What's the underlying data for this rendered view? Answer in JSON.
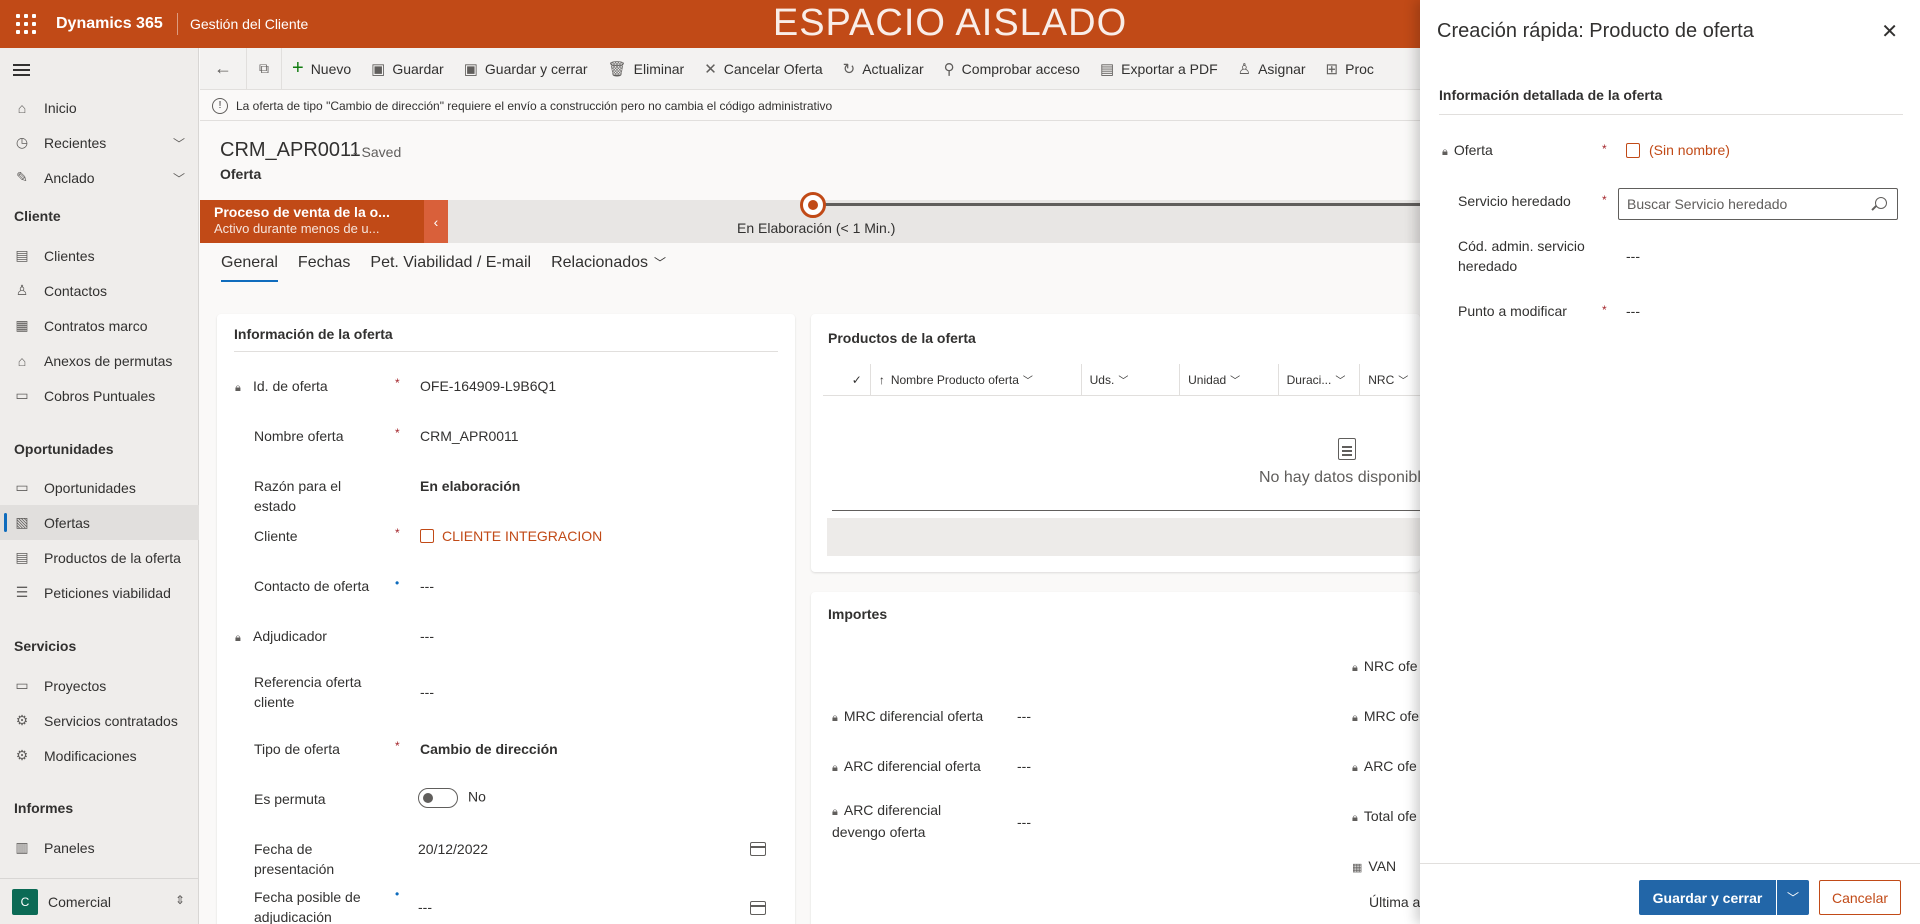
{
  "topbar": {
    "brand": "Dynamics 365",
    "app_name": "Gestión del Cliente",
    "sandbox_banner": "ESPACIO AISLADO"
  },
  "sidenav": {
    "items": [
      {
        "label": "Inicio",
        "icon": "home-icon"
      },
      {
        "label": "Recientes",
        "icon": "clock-icon"
      },
      {
        "label": "Anclado",
        "icon": "pin-icon"
      }
    ],
    "groups": [
      {
        "title": "Cliente",
        "items": [
          "Clientes",
          "Contactos",
          "Contratos marco",
          "Anexos de permutas",
          "Cobros Puntuales"
        ]
      },
      {
        "title": "Oportunidades",
        "items": [
          "Oportunidades",
          "Ofertas",
          "Productos de la oferta",
          "Peticiones viabilidad"
        ]
      },
      {
        "title": "Servicios",
        "items": [
          "Proyectos",
          "Servicios contratados",
          "Modificaciones"
        ]
      },
      {
        "title": "Informes",
        "items": [
          "Paneles"
        ]
      }
    ],
    "active_item": "Ofertas",
    "area": {
      "letter": "C",
      "label": "Comercial"
    }
  },
  "commandbar": {
    "items": [
      "Nuevo",
      "Guardar",
      "Guardar y cerrar",
      "Eliminar",
      "Cancelar Oferta",
      "Actualizar",
      "Comprobar acceso",
      "Exportar a PDF",
      "Asignar",
      "Proc"
    ]
  },
  "notification": "La oferta de tipo \"Cambio de dirección\" requiere el envío a construcción pero no cambia el código administrativo",
  "record": {
    "title": "CRM_APR0011",
    "saved": "- Saved",
    "entity": "Oferta"
  },
  "bpf": {
    "process_name": "Proceso de venta de la o...",
    "process_sub": "Activo durante menos de u...",
    "stage_label": "En Elaboración",
    "stage_duration": "(< 1 Min.)"
  },
  "tabs": [
    "General",
    "Fechas",
    "Pet. Viabilidad / E-mail",
    "Relacionados"
  ],
  "offer_info": {
    "title": "Información de la oferta",
    "fields": [
      {
        "label": "Id. de oferta",
        "value": "OFE-164909-L9B6Q1"
      },
      {
        "label": "Nombre oferta",
        "value": "CRM_APR0011"
      },
      {
        "label": "Razón para el estado",
        "value": "En elaboración"
      },
      {
        "label": "Cliente",
        "value": "CLIENTE INTEGRACION"
      },
      {
        "label": "Contacto de oferta",
        "value": "---"
      },
      {
        "label": "Adjudicador",
        "value": "---"
      },
      {
        "label": "Referencia oferta cliente",
        "value": "---"
      },
      {
        "label": "Tipo de oferta",
        "value": "Cambio de dirección"
      },
      {
        "label": "Es permuta",
        "value": "No"
      },
      {
        "label": "Fecha de presentación",
        "value": "20/12/2022"
      },
      {
        "label": "Fecha posible de adjudicación",
        "value": "---"
      }
    ]
  },
  "products": {
    "title": "Productos de la oferta",
    "columns": [
      "Nombre Producto oferta",
      "Uds.",
      "Unidad",
      "Duraci...",
      "NRC"
    ],
    "empty_text": "No hay datos disponibl"
  },
  "importes": {
    "title": "Importes",
    "fields": [
      {
        "label": "MRC diferencial oferta",
        "value": "---"
      },
      {
        "label": "ARC diferencial oferta",
        "value": "---"
      },
      {
        "label": "ARC diferencial devengo oferta",
        "value": "---"
      }
    ],
    "right_labels": [
      "NRC ofe",
      "MRC ofe",
      "ARC ofe",
      "Total ofe",
      "VAN",
      "Última a"
    ]
  },
  "quick_create": {
    "title": "Creación rápida: Producto de oferta",
    "section": "Información detallada de la oferta",
    "fields": {
      "oferta_label": "Oferta",
      "oferta_value": "(Sin nombre)",
      "servicio_label": "Servicio heredado",
      "servicio_placeholder": "Buscar Servicio heredado",
      "cod_label": "Cód. admin. servicio heredado",
      "cod_value": "---",
      "punto_label": "Punto a modificar",
      "punto_value": "---"
    },
    "save_close": "Guardar y cerrar",
    "cancel": "Cancelar"
  }
}
